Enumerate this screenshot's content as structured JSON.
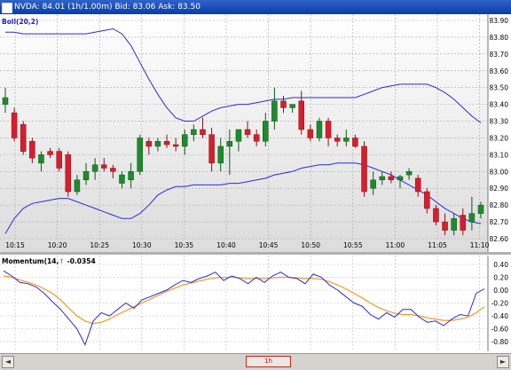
{
  "window": {
    "title": "NVDA: 84.01 (1h/1.00m) Bid: 83.06 Ask: 83.50"
  },
  "main_chart": {
    "indicator_label": "Boll(20,2)",
    "colors": {
      "up": "#1f8a2e",
      "down": "#d61f2c",
      "band": "#2a2adf",
      "bg_top": "#ffffff",
      "bg_bottom": "#dcdcdc"
    },
    "y_ticks": [
      "83.90",
      "83.80",
      "83.70",
      "83.60",
      "83.50",
      "83.40",
      "83.30",
      "83.20",
      "83.10",
      "83.00",
      "82.90",
      "82.80",
      "82.70",
      "82.60"
    ],
    "x_ticks": [
      "10:15",
      "10:20",
      "10:25",
      "10:30",
      "10:35",
      "10:40",
      "10:45",
      "10:50",
      "10:55",
      "11:00",
      "11:05",
      "11:10"
    ]
  },
  "momentum": {
    "label": "Momentum(14,",
    "value": "-0.0354",
    "colors": {
      "momentum": "#2a2adf",
      "signal": "#f29a1e"
    },
    "y_ticks": [
      "0.40",
      "0.20",
      "0.00",
      "-0.20",
      "-0.40",
      "-0.60",
      "-0.80"
    ]
  },
  "scrollbar": {
    "thumb_label": "1h",
    "left_arrow": "◄",
    "right_arrow": "►"
  },
  "chart_data": [
    {
      "type": "candlestick",
      "title": "",
      "indicator": "Bollinger Bands (20,2)",
      "ylim": [
        82.55,
        83.95
      ],
      "x_ticks": [
        "10:15",
        "10:20",
        "10:25",
        "10:30",
        "10:35",
        "10:40",
        "10:45",
        "10:50",
        "10:55",
        "11:00",
        "11:05",
        "11:10"
      ],
      "ohlc": [
        [
          83.4,
          83.5,
          83.35,
          83.44
        ],
        [
          83.35,
          83.38,
          83.18,
          83.2
        ],
        [
          83.28,
          83.3,
          83.1,
          83.12
        ],
        [
          83.18,
          83.2,
          83.05,
          83.08
        ],
        [
          83.05,
          83.12,
          83.0,
          83.1
        ],
        [
          83.12,
          83.14,
          83.08,
          83.1
        ],
        [
          83.12,
          83.14,
          83.0,
          83.02
        ],
        [
          83.1,
          83.12,
          82.85,
          82.88
        ],
        [
          82.88,
          82.98,
          82.86,
          82.95
        ],
        [
          82.95,
          83.05,
          82.92,
          83.0
        ],
        [
          83.0,
          83.08,
          82.95,
          83.04
        ],
        [
          83.04,
          83.08,
          83.0,
          83.02
        ],
        [
          83.02,
          83.04,
          82.96,
          83.0
        ],
        [
          82.93,
          83.0,
          82.9,
          82.98
        ],
        [
          82.95,
          83.05,
          82.9,
          83.0
        ],
        [
          83.0,
          83.22,
          82.98,
          83.2
        ],
        [
          83.18,
          83.2,
          83.1,
          83.15
        ],
        [
          83.15,
          83.2,
          83.12,
          83.18
        ],
        [
          83.18,
          83.22,
          83.14,
          83.16
        ],
        [
          83.16,
          83.2,
          83.12,
          83.15
        ],
        [
          83.15,
          83.25,
          83.1,
          83.22
        ],
        [
          83.22,
          83.28,
          83.18,
          83.25
        ],
        [
          83.25,
          83.32,
          83.2,
          83.22
        ],
        [
          83.22,
          83.26,
          83.0,
          83.05
        ],
        [
          83.05,
          83.2,
          83.0,
          83.15
        ],
        [
          83.15,
          83.25,
          82.98,
          83.18
        ],
        [
          83.18,
          83.25,
          83.12,
          83.25
        ],
        [
          83.25,
          83.3,
          83.2,
          83.22
        ],
        [
          83.22,
          83.25,
          83.15,
          83.18
        ],
        [
          83.18,
          83.35,
          83.15,
          83.3
        ],
        [
          83.3,
          83.5,
          83.25,
          83.42
        ],
        [
          83.42,
          83.45,
          83.35,
          83.38
        ],
        [
          83.38,
          83.4,
          83.35,
          83.4
        ],
        [
          83.42,
          83.48,
          83.22,
          83.25
        ],
        [
          83.25,
          83.28,
          83.18,
          83.2
        ],
        [
          83.2,
          83.32,
          83.18,
          83.3
        ],
        [
          83.3,
          83.32,
          83.15,
          83.2
        ],
        [
          83.2,
          83.22,
          83.15,
          83.18
        ],
        [
          83.18,
          83.25,
          83.15,
          83.2
        ],
        [
          83.2,
          83.22,
          83.14,
          83.15
        ],
        [
          83.15,
          83.18,
          82.85,
          82.88
        ],
        [
          82.9,
          83.0,
          82.86,
          82.95
        ],
        [
          82.95,
          83.0,
          82.92,
          82.97
        ],
        [
          82.97,
          83.0,
          82.93,
          82.95
        ],
        [
          82.95,
          82.98,
          82.9,
          82.97
        ],
        [
          82.98,
          83.02,
          82.95,
          83.0
        ],
        [
          82.96,
          82.98,
          82.85,
          82.88
        ],
        [
          82.88,
          82.9,
          82.75,
          82.78
        ],
        [
          82.78,
          82.8,
          82.68,
          82.7
        ],
        [
          82.7,
          82.75,
          82.62,
          82.65
        ],
        [
          82.65,
          82.75,
          82.62,
          82.72
        ],
        [
          82.74,
          82.78,
          82.62,
          82.65
        ],
        [
          82.7,
          82.85,
          82.65,
          82.75
        ],
        [
          82.75,
          82.82,
          82.72,
          82.8
        ]
      ],
      "upper_band": [
        83.83,
        83.83,
        83.82,
        83.82,
        83.82,
        83.82,
        83.82,
        83.82,
        83.82,
        83.82,
        83.83,
        83.84,
        83.85,
        83.82,
        83.75,
        83.65,
        83.55,
        83.46,
        83.38,
        83.32,
        83.3,
        83.3,
        83.33,
        83.36,
        83.38,
        83.39,
        83.4,
        83.4,
        83.41,
        83.42,
        83.43,
        83.43,
        83.44,
        83.44,
        83.44,
        83.44,
        83.44,
        83.44,
        83.44,
        83.44,
        83.46,
        83.48,
        83.5,
        83.51,
        83.52,
        83.52,
        83.52,
        83.52,
        83.5,
        83.47,
        83.43,
        83.38,
        83.33,
        83.29
      ],
      "lower_band": [
        82.63,
        82.72,
        82.78,
        82.81,
        82.82,
        82.83,
        82.84,
        82.84,
        82.82,
        82.8,
        82.78,
        82.76,
        82.74,
        82.72,
        82.72,
        82.75,
        82.8,
        82.86,
        82.89,
        82.91,
        82.91,
        82.92,
        82.92,
        82.92,
        82.92,
        82.93,
        82.93,
        82.94,
        82.95,
        82.96,
        82.98,
        82.99,
        83.0,
        83.02,
        83.03,
        83.04,
        83.04,
        83.05,
        83.05,
        83.05,
        83.04,
        83.02,
        83.0,
        82.98,
        82.95,
        82.92,
        82.89,
        82.86,
        82.82,
        82.78,
        82.75,
        82.72,
        82.7,
        82.69
      ]
    },
    {
      "type": "line",
      "title": "",
      "ylim": [
        -0.85,
        0.5
      ],
      "series": [
        {
          "values": [
            0.3,
            0.22,
            0.12,
            0.1,
            0.05,
            -0.05,
            -0.18,
            -0.3,
            -0.45,
            -0.6,
            -0.85,
            -0.48,
            -0.35,
            -0.4,
            -0.3,
            -0.2,
            -0.28,
            -0.15,
            -0.1,
            -0.05,
            0.0,
            0.08,
            0.15,
            0.12,
            0.18,
            0.22,
            0.28,
            0.15,
            0.22,
            0.18,
            0.1,
            0.2,
            0.12,
            0.22,
            0.28,
            0.2,
            0.18,
            0.1,
            0.25,
            0.2,
            0.08,
            0.0,
            -0.1,
            -0.2,
            -0.25,
            -0.38,
            -0.45,
            -0.35,
            -0.42,
            -0.3,
            -0.3,
            -0.42,
            -0.5,
            -0.48,
            -0.55,
            -0.45,
            -0.38,
            -0.4,
            -0.05,
            0.02
          ]
        },
        {
          "values": [
            0.22,
            0.2,
            0.16,
            0.12,
            0.08,
            0.02,
            -0.05,
            -0.15,
            -0.28,
            -0.4,
            -0.48,
            -0.52,
            -0.5,
            -0.45,
            -0.38,
            -0.32,
            -0.26,
            -0.2,
            -0.14,
            -0.08,
            -0.02,
            0.03,
            0.08,
            0.11,
            0.14,
            0.17,
            0.19,
            0.2,
            0.2,
            0.19,
            0.18,
            0.18,
            0.18,
            0.19,
            0.2,
            0.2,
            0.19,
            0.18,
            0.18,
            0.17,
            0.13,
            0.08,
            0.02,
            -0.05,
            -0.12,
            -0.2,
            -0.27,
            -0.32,
            -0.36,
            -0.38,
            -0.38,
            -0.4,
            -0.43,
            -0.45,
            -0.47,
            -0.47,
            -0.45,
            -0.42,
            -0.35,
            -0.26
          ]
        }
      ]
    }
  ]
}
